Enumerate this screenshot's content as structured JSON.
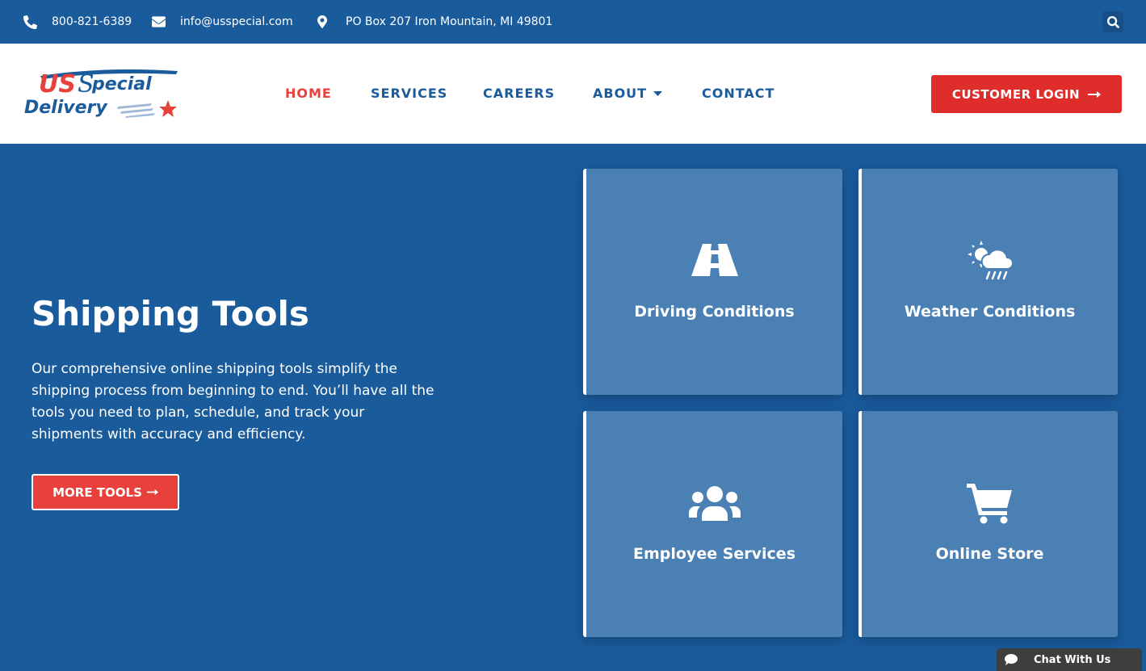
{
  "topbar": {
    "phone": "800-821-6389",
    "email": "info@usspecial.com",
    "address": "PO Box 207 Iron Mountain, MI 49801"
  },
  "logo": {
    "line1": "USpecial",
    "line2": "Delivery"
  },
  "nav": {
    "home": "HOME",
    "services": "SERVICES",
    "careers": "CAREERS",
    "about": "ABOUT",
    "contact": "CONTACT"
  },
  "login": {
    "label": "CUSTOMER LOGIN"
  },
  "hero": {
    "title": "Shipping Tools",
    "text": "Our comprehensive online shipping tools simplify the shipping process from beginning to end. You’ll have all the tools you need to plan, schedule, and track your shipments with accuracy and efficiency.",
    "button": "MORE TOOLS"
  },
  "cards": [
    {
      "label": "Driving Conditions",
      "icon": "road-icon"
    },
    {
      "label": "Weather Conditions",
      "icon": "cloud-sun-rain-icon"
    },
    {
      "label": "Employee Services",
      "icon": "users-icon"
    },
    {
      "label": "Online Store",
      "icon": "shopping-cart-icon"
    }
  ],
  "chat": {
    "label": "Chat With Us"
  },
  "colors": {
    "brand_blue": "#1a5b9c",
    "accent_red": "#de2d2b",
    "card_blue": "#4a80b3"
  }
}
